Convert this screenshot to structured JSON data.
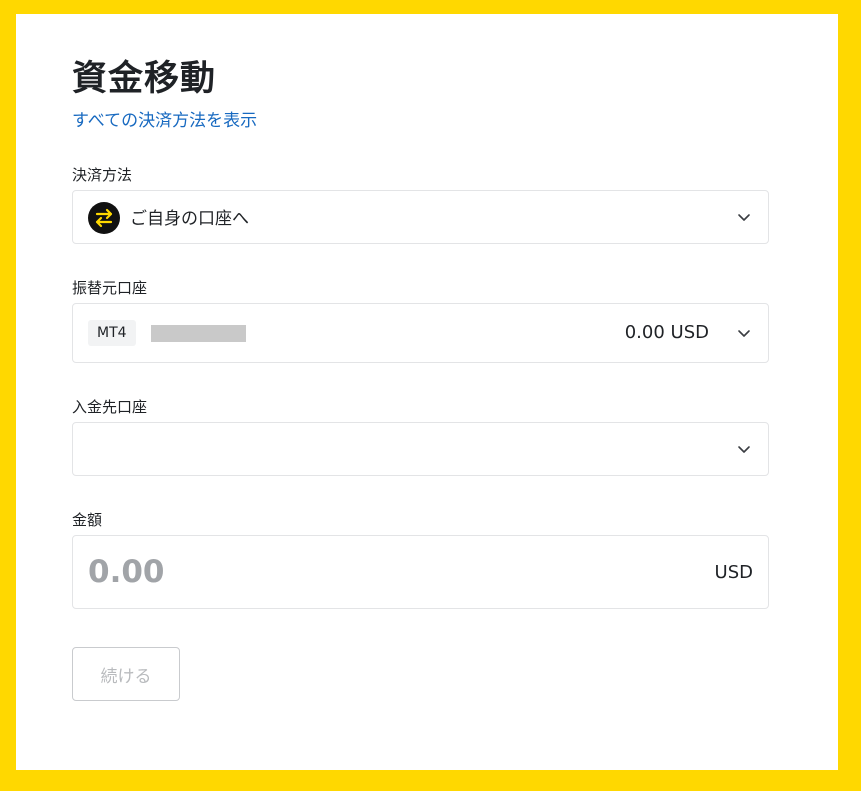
{
  "page_title": "資金移動",
  "show_all_methods_link": "すべての決済方法を表示",
  "payment_method": {
    "label": "決済方法",
    "selected": "ご自身の口座へ",
    "icon": "transfer-arrows-icon"
  },
  "source_account": {
    "label": "振替元口座",
    "platform": "MT4",
    "balance": "0.00 USD"
  },
  "destination_account": {
    "label": "入金先口座",
    "selected": ""
  },
  "amount": {
    "label": "金額",
    "placeholder": "0.00",
    "currency": "USD"
  },
  "continue_button": "続ける",
  "colors": {
    "frame": "#ffd800",
    "link": "#1769c0",
    "icon_arrows": "#ffd800"
  }
}
